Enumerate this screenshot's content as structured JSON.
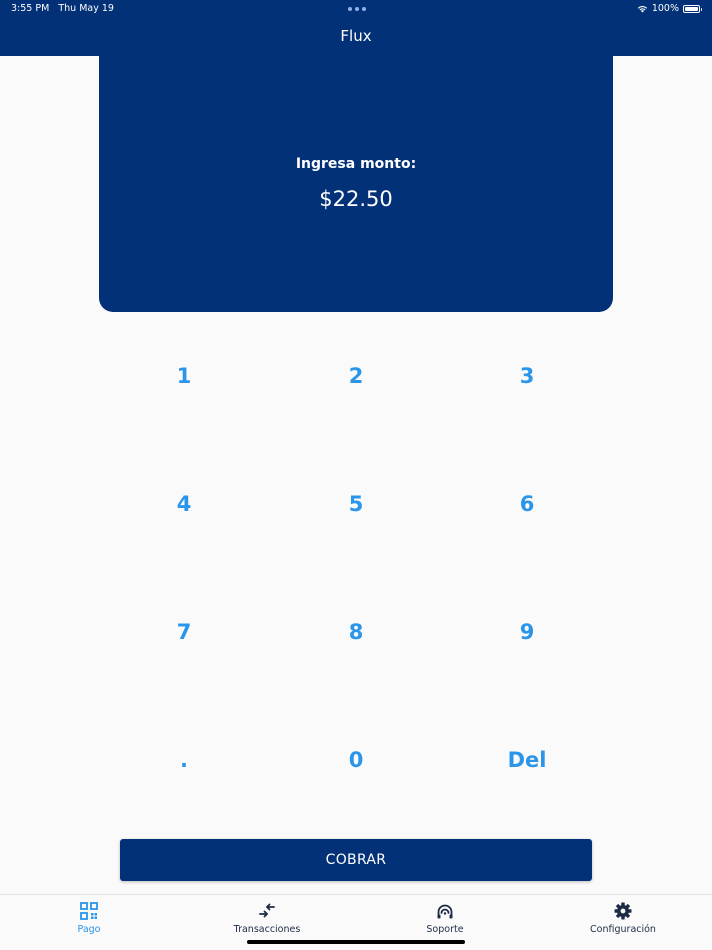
{
  "status_bar": {
    "time": "3:55 PM",
    "date": "Thu May 19",
    "battery": "100%"
  },
  "app": {
    "title": "Flux"
  },
  "amount": {
    "label": "Ingresa monto:",
    "value": "$22.50"
  },
  "keypad": {
    "keys": [
      "1",
      "2",
      "3",
      "4",
      "5",
      "6",
      "7",
      "8",
      "9",
      ".",
      "0",
      "Del"
    ]
  },
  "actions": {
    "charge_label": "COBRAR"
  },
  "tabs": [
    {
      "label": "Pago",
      "icon": "qr-code-icon",
      "active": true
    },
    {
      "label": "Transacciones",
      "icon": "swap-arrows-icon",
      "active": false
    },
    {
      "label": "Soporte",
      "icon": "support-headset-icon",
      "active": false
    },
    {
      "label": "Configuración",
      "icon": "gear-icon",
      "active": false
    }
  ],
  "colors": {
    "primary": "#033177",
    "accent": "#2b95e9",
    "background": "#fafafa"
  }
}
